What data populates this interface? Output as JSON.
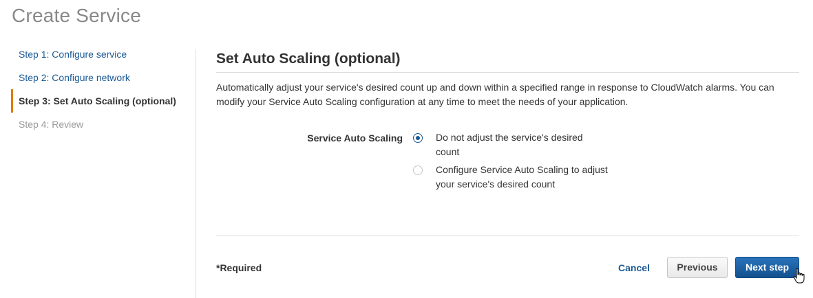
{
  "page": {
    "title": "Create Service"
  },
  "sidebar": {
    "steps": [
      {
        "label": "Step 1: Configure service",
        "state": "link"
      },
      {
        "label": "Step 2: Configure network",
        "state": "link"
      },
      {
        "label": "Step 3: Set Auto Scaling (optional)",
        "state": "active"
      },
      {
        "label": "Step 4: Review",
        "state": "disabled"
      }
    ]
  },
  "main": {
    "title": "Set Auto Scaling (optional)",
    "description": "Automatically adjust your service's desired count up and down within a specified range in response to CloudWatch alarms. You can modify your Service Auto Scaling configuration at any time to meet the needs of your application.",
    "form": {
      "label": "Service Auto Scaling",
      "options": [
        {
          "label": "Do not adjust the service's desired count",
          "selected": true
        },
        {
          "label": "Configure Service Auto Scaling to adjust your service's desired count",
          "selected": false
        }
      ]
    }
  },
  "footer": {
    "required_note": "*Required",
    "cancel_label": "Cancel",
    "previous_label": "Previous",
    "next_label": "Next step"
  },
  "colors": {
    "link": "#1a5a96",
    "active_marker": "#e07b00",
    "primary_button": "#1a5a96"
  },
  "icons": {
    "cursor": "hand-pointer-icon"
  }
}
